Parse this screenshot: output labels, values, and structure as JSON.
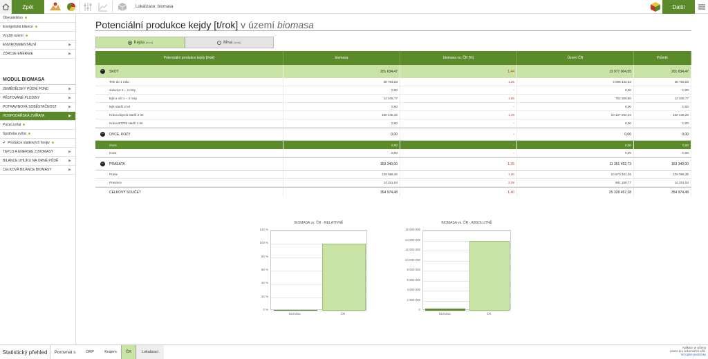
{
  "topbar": {
    "back_label": "Zpět",
    "next_label": "Další",
    "location": "Lokalizace: biomasa"
  },
  "sidebar": {
    "top_items": [
      {
        "label": "Obyvatelstvo",
        "dot": true
      },
      {
        "label": "Energetická bilance",
        "dot": true
      },
      {
        "label": "Využití území",
        "dot": true
      },
      {
        "label": "Environmentální",
        "upper": true,
        "arrow": true
      },
      {
        "label": "Zdroje energie",
        "upper": true,
        "arrow": true
      }
    ],
    "module_title": "MODUL BIOMASA",
    "module_items": [
      {
        "label": "Zemědělský půdní fond",
        "upper": true,
        "arrow": true
      },
      {
        "label": "Pěstované plodiny",
        "upper": true,
        "arrow": true
      },
      {
        "label": "Potravinová soběstačnost",
        "upper": true,
        "arrow": true
      },
      {
        "label": "Hospodářská zvířata",
        "upper": true,
        "arrow": true,
        "active": true
      },
      {
        "label": "Počet zvířat",
        "dot": true
      },
      {
        "label": "Spotřeba zvířat",
        "dot": true
      },
      {
        "label": "Produkce statkových hnojiv",
        "dot": true,
        "check": true
      },
      {
        "label": "Teplo a energie z biomasy",
        "upper": true,
        "arrow": true
      },
      {
        "label": "Bilance uhlíku na orné půdě",
        "upper": true,
        "arrow": true
      },
      {
        "label": "Celková bilance biomasy",
        "upper": true,
        "arrow": true
      }
    ]
  },
  "page": {
    "title_main": "Potenciální produkce kejdy [t/rok]",
    "title_in": "v území",
    "title_region": "biomasa"
  },
  "toggle": {
    "options": [
      {
        "label": "Kejda",
        "unit": "[t/rok]",
        "selected": true
      },
      {
        "label": "Mrva",
        "unit": "[t/rok]",
        "selected": false
      }
    ]
  },
  "table": {
    "headers": [
      "Potenciální produkce kejdy [t/rok]",
      "biomasa",
      "biomasa vs. ČR [%]",
      "Území ČR",
      "Průměr"
    ],
    "groups": [
      {
        "name": "SKOT",
        "values": [
          "201 634,47",
          "1,44",
          "13 977 004,55",
          "201 634,47"
        ],
        "shaded": true,
        "rows": [
          {
            "name": "Tele do 1 roku",
            "values": [
              "38 783,83",
              "1,25",
              "3 098 432,52",
              "38 783,83"
            ]
          },
          {
            "name": "Jalovice 1 – 2 roky",
            "values": [
              "0,00",
              "-",
              "0,00",
              "0,00"
            ]
          },
          {
            "name": "Býk a vůl 1 – 2 roky",
            "values": [
              "12 405,77",
              "1,65",
              "753 309,60",
              "12 405,77"
            ]
          },
          {
            "name": "Býk starší 2 let",
            "values": [
              "0,00",
              "-",
              "0,00",
              "0,00"
            ]
          },
          {
            "name": "Kráva dojená starší 2 let",
            "values": [
              "150 445,26",
              "1,49",
              "10 127 262,43",
              "150 445,26"
            ]
          },
          {
            "name": "Kráva BTPM starší 2 let",
            "values": [
              "0,00",
              "-",
              "0,00",
              "0,00"
            ]
          }
        ]
      },
      {
        "name": "OVCE, KOZY",
        "values": [
          "0,00",
          "-",
          "0,00",
          "0,00"
        ],
        "shaded": false,
        "rows": [
          {
            "name": "Ovce",
            "values": [
              "0,00",
              "-",
              "0,00",
              "0,00"
            ],
            "selected": true
          },
          {
            "name": "Koza",
            "values": [
              "0,00",
              "-",
              "0,00",
              "0,00"
            ]
          }
        ]
      },
      {
        "name": "PRASATA",
        "values": [
          "153 340,00",
          "1,35",
          "11 351 452,73",
          "153 340,00"
        ],
        "shaded": false,
        "rows": [
          {
            "name": "Prase",
            "values": [
              "139 088,36",
              "1,30",
              "10 670 301,36",
              "139 088,36"
            ]
          },
          {
            "name": "Prasnice",
            "values": [
              "14 251,64",
              "2,09",
              "681 150,77",
              "14 251,64"
            ]
          }
        ]
      }
    ],
    "total": {
      "name": "CELKOVÝ SOUČET",
      "values": [
        "354 974,48",
        "1,40",
        "25 328 457,28",
        "354 974,48"
      ]
    }
  },
  "chart_data": [
    {
      "type": "bar",
      "title": "BIOMASA  vs.  ČR  - RELATIVNĚ",
      "categories": [
        "biomasa",
        "ČR"
      ],
      "values": [
        1.4,
        100
      ],
      "yticks": [
        "120 %",
        "100 %",
        "80 %",
        "60 %",
        "40 %",
        "20 %",
        "0 %"
      ],
      "ylim": [
        0,
        120
      ]
    },
    {
      "type": "bar",
      "title": "BIOMASA  vs.  ČR  - ABSOLUTNĚ",
      "categories": [
        "biomasa",
        "ČR"
      ],
      "values": [
        354974.48,
        14000000
      ],
      "yticks": [
        "16 000 000",
        "14 000 000",
        "12 000 000",
        "10 000 000",
        "8 000 000",
        "6 000 000",
        "4 000 000",
        "2 000 000",
        "0"
      ],
      "ylim": [
        0,
        16000000
      ]
    }
  ],
  "bottombar": {
    "stat_label": "Statistický přehled",
    "compare_label": "Porovnat s",
    "items": [
      "ORP",
      "Krajem",
      "ČR",
      "Lokalizací"
    ],
    "active": "ČR",
    "note_line1": "Aplikace je určena",
    "note_line2": "pouze pro nekomerční užití.",
    "note_link": "Viz úplné podmínky"
  }
}
